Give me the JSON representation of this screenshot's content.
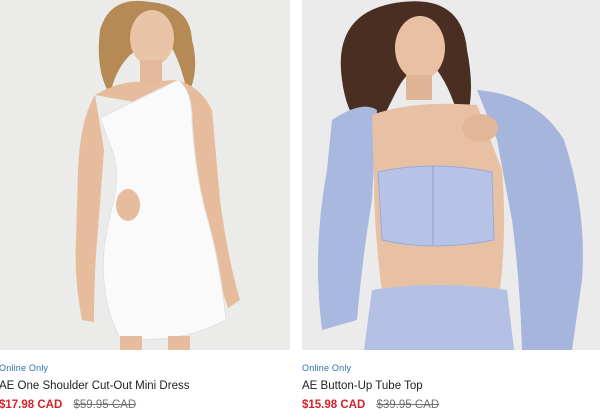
{
  "products": [
    {
      "badge": "Online Only",
      "title": "AE One Shoulder Cut-Out Mini Dress",
      "sale_price": "$17.98 CAD",
      "original_price": "$59.95 CAD",
      "image_alt": "Model wearing a white one-shoulder cut-out mini dress"
    },
    {
      "badge": "Online Only",
      "title": "AE Button-Up Tube Top",
      "sale_price": "$15.98 CAD",
      "original_price": "$39.95 CAD",
      "image_alt": "Model wearing a blue striped button-up tube top with matching shorts and open shirt"
    }
  ],
  "colors": {
    "badge": "#2e6fb0",
    "sale_price": "#d2232a",
    "original_price": "#707070",
    "title": "#1f1f1f"
  }
}
